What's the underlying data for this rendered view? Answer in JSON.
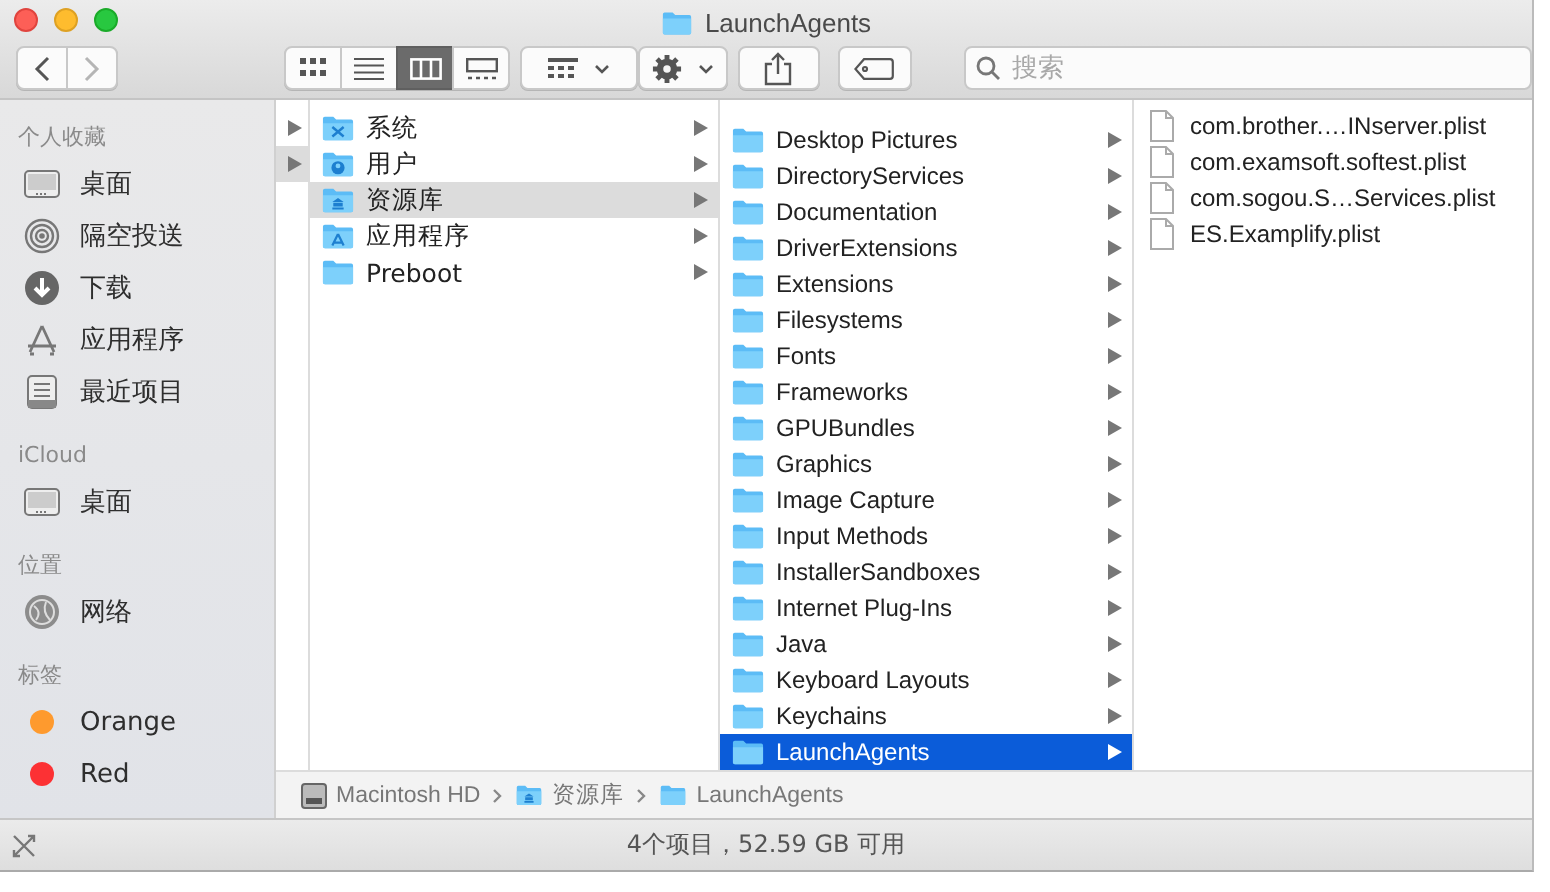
{
  "window": {
    "title": "LaunchAgents"
  },
  "toolbar": {
    "nav": [
      {
        "kind": "back",
        "disabled": false
      },
      {
        "kind": "forward",
        "disabled": true
      }
    ],
    "view_modes": [
      {
        "kind": "icons",
        "selected": false
      },
      {
        "kind": "list",
        "selected": false
      },
      {
        "kind": "columns",
        "selected": true
      },
      {
        "kind": "gallery",
        "selected": false
      }
    ],
    "buttons": [
      {
        "kind": "group"
      },
      {
        "kind": "action"
      },
      {
        "kind": "share"
      },
      {
        "kind": "tag"
      }
    ],
    "search": {
      "placeholder": "搜索"
    }
  },
  "sidebar": [
    {
      "title": "个人收藏",
      "items": [
        {
          "label": "桌面",
          "kind": "desktop"
        },
        {
          "label": "隔空投送",
          "kind": "airdrop"
        },
        {
          "label": "下载",
          "kind": "downloads"
        },
        {
          "label": "应用程序",
          "kind": "apps"
        },
        {
          "label": "最近项目",
          "kind": "recents"
        }
      ]
    },
    {
      "title": "iCloud",
      "items": [
        {
          "label": "桌面",
          "kind": "desktop"
        }
      ]
    },
    {
      "title": "位置",
      "items": [
        {
          "label": "网络",
          "kind": "network"
        }
      ]
    },
    {
      "title": "标签",
      "items": [
        {
          "label": "Orange",
          "kind": "tag",
          "color": "#fe9a2e"
        },
        {
          "label": "Red",
          "kind": "tag",
          "color": "#fc3134"
        }
      ]
    }
  ],
  "columns": [
    {
      "focused": false,
      "items": [
        {
          "selected": false,
          "has_children": true
        },
        {
          "selected": true,
          "has_children": true
        }
      ]
    },
    {
      "focused": false,
      "items": [
        {
          "label": "系统",
          "kind": "system",
          "selected": false,
          "has_children": true
        },
        {
          "label": "用户",
          "kind": "users",
          "selected": false,
          "has_children": true
        },
        {
          "label": "资源库",
          "kind": "library",
          "selected": true,
          "has_children": true
        },
        {
          "label": "应用程序",
          "kind": "apps",
          "selected": false,
          "has_children": true
        },
        {
          "label": "Preboot",
          "kind": "folder",
          "selected": false,
          "has_children": true
        }
      ]
    },
    {
      "focused": true,
      "items": [
        {
          "label": "Desktop Pictures",
          "kind": "folder",
          "selected": false,
          "has_children": true
        },
        {
          "label": "DirectoryServices",
          "kind": "folder",
          "selected": false,
          "has_children": true
        },
        {
          "label": "Documentation",
          "kind": "folder",
          "selected": false,
          "has_children": true
        },
        {
          "label": "DriverExtensions",
          "kind": "folder",
          "selected": false,
          "has_children": true
        },
        {
          "label": "Extensions",
          "kind": "folder",
          "selected": false,
          "has_children": true
        },
        {
          "label": "Filesystems",
          "kind": "folder",
          "selected": false,
          "has_children": true
        },
        {
          "label": "Fonts",
          "kind": "folder",
          "selected": false,
          "has_children": true
        },
        {
          "label": "Frameworks",
          "kind": "folder",
          "selected": false,
          "has_children": true
        },
        {
          "label": "GPUBundles",
          "kind": "folder",
          "selected": false,
          "has_children": true
        },
        {
          "label": "Graphics",
          "kind": "folder",
          "selected": false,
          "has_children": true
        },
        {
          "label": "Image Capture",
          "kind": "folder",
          "selected": false,
          "has_children": true
        },
        {
          "label": "Input Methods",
          "kind": "folder",
          "selected": false,
          "has_children": true
        },
        {
          "label": "InstallerSandboxes",
          "kind": "folder",
          "selected": false,
          "has_children": true
        },
        {
          "label": "Internet Plug-Ins",
          "kind": "folder",
          "selected": false,
          "has_children": true
        },
        {
          "label": "Java",
          "kind": "folder",
          "selected": false,
          "has_children": true
        },
        {
          "label": "Keyboard Layouts",
          "kind": "folder",
          "selected": false,
          "has_children": true
        },
        {
          "label": "Keychains",
          "kind": "folder",
          "selected": false,
          "has_children": true
        },
        {
          "label": "LaunchAgents",
          "kind": "folder",
          "selected": true,
          "has_children": true
        }
      ]
    },
    {
      "items": [
        {
          "label": "com.brother.…INserver.plist",
          "kind": "file",
          "selected": false
        },
        {
          "label": "com.examsoft.softest.plist",
          "kind": "file",
          "selected": false
        },
        {
          "label": "com.sogou.S…Services.plist",
          "kind": "file",
          "selected": false
        },
        {
          "label": "ES.Examplify.plist",
          "kind": "file",
          "selected": false
        }
      ]
    }
  ],
  "path_bar": [
    {
      "label": "Macintosh HD",
      "kind": "drive"
    },
    {
      "label": "资源库",
      "kind": "library"
    },
    {
      "label": "LaunchAgents",
      "kind": "folder"
    }
  ],
  "status_bar": {
    "text": "4个项目，52.59 GB 可用"
  }
}
